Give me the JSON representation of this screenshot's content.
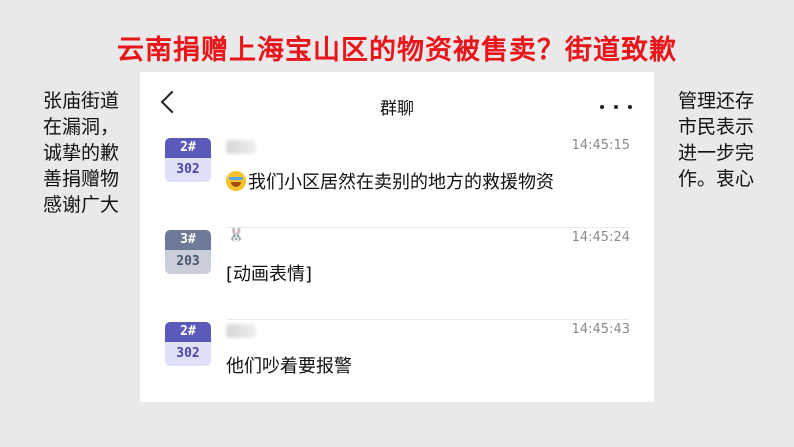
{
  "slide": {
    "title": "云南捐赠上海宝山区的物资被售卖？街道致歉",
    "body_left": [
      "张庙街道",
      "在漏洞，",
      "诚挚的歉",
      "善捐赠物",
      "感谢广大"
    ],
    "body_right": [
      "管理还存",
      "市民表示",
      "进一步完",
      "作。衷心",
      ""
    ]
  },
  "chat": {
    "title": "群聊",
    "back_icon": "chevron-left-icon",
    "more_icon": "ellipsis-icon",
    "messages": [
      {
        "avatar_top": "2#",
        "avatar_bottom": "302",
        "avatar_color": "#5a58b8",
        "time": "14:45:15",
        "emoji": "crying-laughing-emoji",
        "text": "我们小区居然在卖别的地方的救援物资"
      },
      {
        "avatar_top": "3#",
        "avatar_bottom": "203",
        "avatar_color": "#6f7a9a",
        "sender_icon": "rabbit-icon",
        "time": "14:45:24",
        "text": "[动画表情]"
      },
      {
        "avatar_top": "2#",
        "avatar_bottom": "302",
        "avatar_color": "#5a58b8",
        "time": "14:45:43",
        "text": "他们吵着要报警"
      }
    ]
  }
}
